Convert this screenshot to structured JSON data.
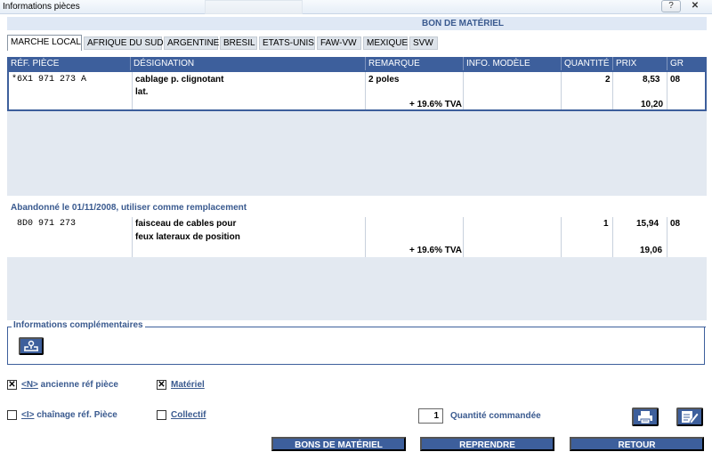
{
  "window": {
    "title": "Informations pièces",
    "help_label": "?",
    "close_label": "✕"
  },
  "header": {
    "title": "BON DE MATÉRIEL"
  },
  "tabs": [
    "MARCHE LOCAL",
    "AFRIQUE DU SUD",
    "ARGENTINE",
    "BRESIL",
    "ETATS-UNIS",
    "FAW-VW",
    "MEXIQUE",
    "SVW"
  ],
  "columns": {
    "ref": "RÉF. PIÈCE",
    "designation": "DÉSIGNATION",
    "remarque": "REMARQUE",
    "info_modele": "INFO. MODÈLE",
    "quantite": "QUANTITÉ",
    "prix": "PRIX",
    "gr": "GR"
  },
  "rows": [
    {
      "ref": "*6X1 971 273 A",
      "designation_1": "cablage p. clignotant",
      "designation_2": "lat.",
      "remarque": "2 poles",
      "tva": "+ 19.6% TVA",
      "quantite": "2",
      "prix": "8,53",
      "prix_ttc": "10,20",
      "gr": "08"
    }
  ],
  "replacement": {
    "notice": "Abandonné le 01/11/2008, utiliser comme remplacement",
    "row": {
      "ref": "8D0 971 273",
      "designation_1": "faisceau de cables pour",
      "designation_2": "feux lateraux de position",
      "tva": "+ 19.6% TVA",
      "quantite": "1",
      "prix": "15,94",
      "prix_ttc": "19,06",
      "gr": "08"
    }
  },
  "info_comp": {
    "legend": "Informations complémentaires"
  },
  "options": {
    "ancienne_ref": {
      "label_key": "<N>",
      "label": " ancienne réf pièce",
      "checked": true,
      "mark": "✕"
    },
    "chainage": {
      "label_key": "<I>",
      "label": " chaînage réf. Pièce",
      "checked": false
    },
    "materiel": {
      "label": "Matériel",
      "checked": true,
      "mark": "✕"
    },
    "collectif": {
      "label": "Collectif",
      "checked": false
    }
  },
  "quantity": {
    "value": "1",
    "label": "Quantité commandée"
  },
  "buttons": {
    "bons": "BONS DE MATÉRIEL",
    "reprendre": "REPRENDRE",
    "retour": "RETOUR"
  },
  "colors": {
    "accent": "#3d5f9c",
    "panel": "#e3e9f1",
    "header_bg": "#dfe8f5",
    "label_text": "#3a5a8f"
  }
}
